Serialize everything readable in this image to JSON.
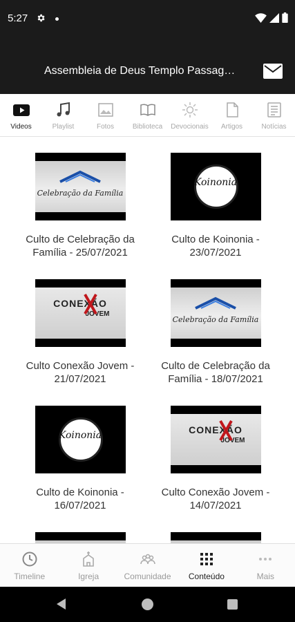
{
  "status_bar": {
    "time": "5:27",
    "icons": [
      "gear-icon",
      "wifi-icon",
      "signal-icon",
      "battery-icon"
    ]
  },
  "header": {
    "title": "Assembleia de Deus Templo Passag…",
    "action_icon": "mail-icon"
  },
  "tabs": [
    {
      "label": "Videos",
      "icon": "video-play-icon",
      "active": true
    },
    {
      "label": "Playlist",
      "icon": "music-note-icon",
      "active": false
    },
    {
      "label": "Fotos",
      "icon": "photo-icon",
      "active": false
    },
    {
      "label": "Biblioteca",
      "icon": "book-icon",
      "active": false
    },
    {
      "label": "Devocionais",
      "icon": "sun-icon",
      "active": false
    },
    {
      "label": "Artigos",
      "icon": "document-icon",
      "active": false
    },
    {
      "label": "Notícias",
      "icon": "newspaper-icon",
      "active": false
    }
  ],
  "videos": [
    {
      "title": "Culto de Celebração da Família - 25/07/2021",
      "thumb": "celebracao",
      "thumb_text": "Celebração da Família"
    },
    {
      "title": "Culto de Koinonia - 23/07/2021",
      "thumb": "koinonia",
      "thumb_text": "Koinonia"
    },
    {
      "title": "Culto Conexão Jovem - 21/07/2021",
      "thumb": "conexao",
      "thumb_text": "CONEXÃO",
      "thumb_subtext": "JOVEM"
    },
    {
      "title": "Culto de Celebração da Família - 18/07/2021",
      "thumb": "celebracao",
      "thumb_text": "Celebração da Família"
    },
    {
      "title": "Culto de Koinonia - 16/07/2021",
      "thumb": "koinonia",
      "thumb_text": "Koinonia"
    },
    {
      "title": "Culto Conexão Jovem - 14/07/2021",
      "thumb": "conexao",
      "thumb_text": "CONEXÃO",
      "thumb_subtext": "JOVEM"
    }
  ],
  "bottom_nav": [
    {
      "label": "Timeline",
      "icon": "clock-icon",
      "active": false
    },
    {
      "label": "Igreja",
      "icon": "church-icon",
      "active": false
    },
    {
      "label": "Comunidade",
      "icon": "people-icon",
      "active": false
    },
    {
      "label": "Conteúdo",
      "icon": "grid-icon",
      "active": true
    },
    {
      "label": "Mais",
      "icon": "more-icon",
      "active": false
    }
  ],
  "colors": {
    "bar_bg": "#1b1b1b",
    "active_text": "#222222",
    "inactive_text": "#a8a8a8"
  }
}
